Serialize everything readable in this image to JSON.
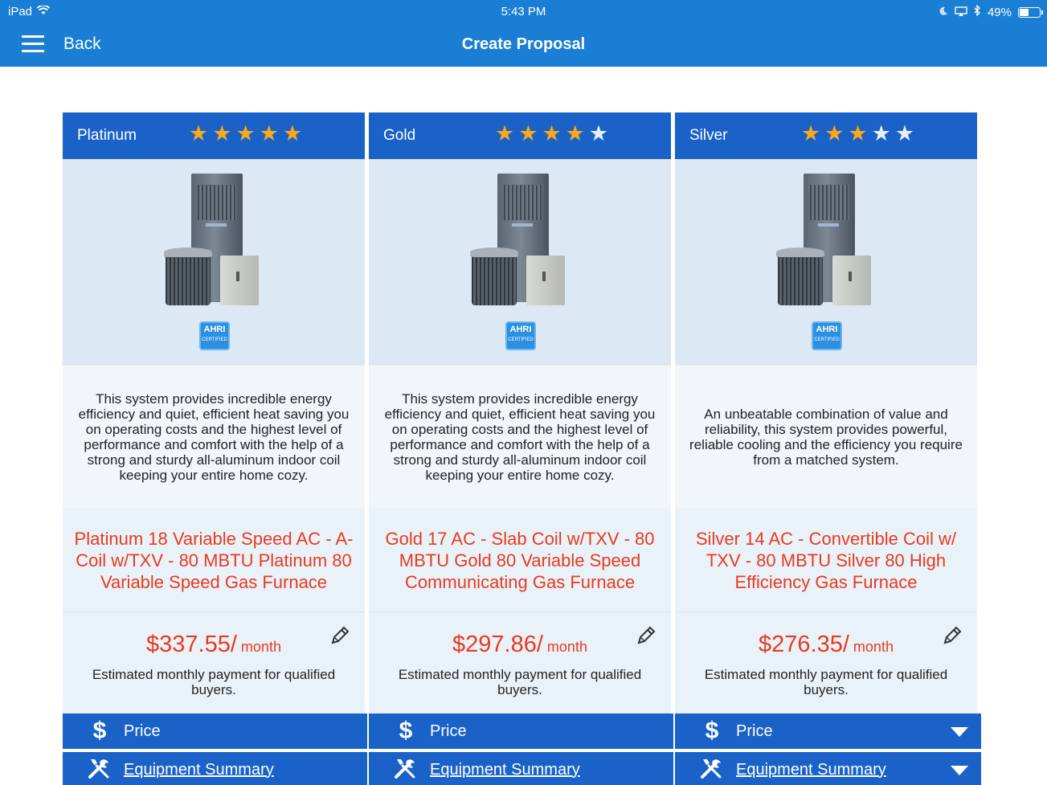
{
  "status_bar": {
    "device": "iPad",
    "time": "5:43 PM",
    "battery_percent": "49%",
    "battery_level": 0.49
  },
  "nav": {
    "back_label": "Back",
    "title": "Create Proposal"
  },
  "colors": {
    "brand_blue": "#1a7fd4",
    "card_header_blue": "#1a62c8",
    "price_red": "#e83a1e",
    "star_gold": "#f7a91b"
  },
  "ahri": {
    "line1": "AHRI",
    "line2": "CERTIFIED"
  },
  "cards": [
    {
      "tier": "Platinum",
      "rating": 5,
      "max_rating": 5,
      "description": "This system provides incredible energy efficiency and quiet, efficient heat saving you on operating costs and the highest level of performance and comfort with the help of a strong and sturdy all-aluminum indoor coil keeping your entire home cozy.",
      "product_name": "Platinum 18 Variable Speed AC - A-Coil w/TXV - 80 MBTU Platinum 80 Variable Speed Gas Furnace",
      "price": "$337.55/",
      "price_unit": "month",
      "price_note": "Estimated monthly payment for qualified buyers.",
      "price_bar_label": "Price",
      "summary_bar_label": "Equipment Summary"
    },
    {
      "tier": "Gold",
      "rating": 4,
      "max_rating": 5,
      "description": "This system provides incredible energy efficiency and quiet, efficient heat saving you on operating costs and the highest level of performance and comfort with the help of a strong and sturdy all-aluminum indoor coil keeping your entire home cozy.",
      "product_name": "Gold 17 AC - Slab Coil w/TXV - 80 MBTU Gold 80 Variable Speed Communicating Gas Furnace",
      "price": "$297.86/",
      "price_unit": "month",
      "price_note": "Estimated monthly payment for qualified buyers.",
      "price_bar_label": "Price",
      "summary_bar_label": "Equipment Summary"
    },
    {
      "tier": "Silver",
      "rating": 3,
      "max_rating": 5,
      "description": "An unbeatable combination of value and reliability, this system provides powerful, reliable cooling and the efficiency you require from a matched system.",
      "product_name": "Silver 14 AC - Convertible Coil w/ TXV - 80 MBTU Silver 80 High Efficiency Gas Furnace",
      "price": "$276.35/",
      "price_unit": "month",
      "price_note": "Estimated monthly payment for qualified buyers.",
      "price_bar_label": "Price",
      "summary_bar_label": "Equipment Summary"
    }
  ],
  "icons": {
    "menu": "hamburger-menu-icon",
    "edit": "pencil-icon",
    "price": "dollar-icon",
    "summary": "tools-icon",
    "expand": "chevron-down-icon"
  }
}
